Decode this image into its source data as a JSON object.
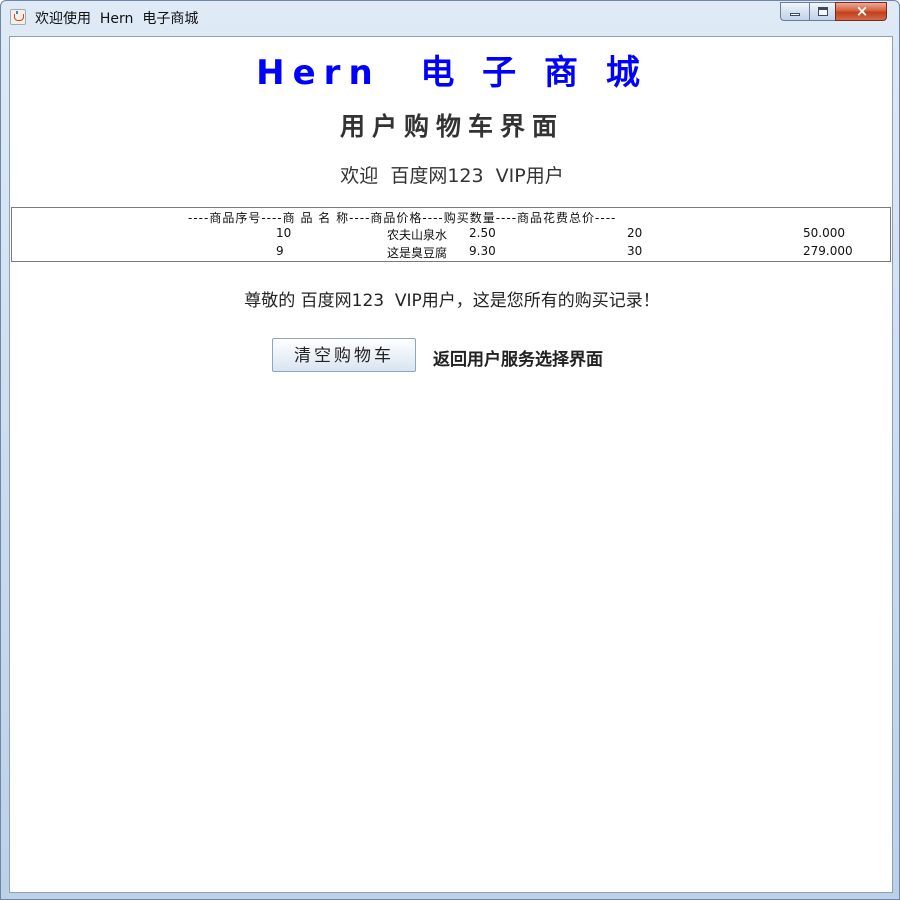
{
  "window": {
    "title": "欢迎使用  Hern  电子商城",
    "icon": "java-cup-icon",
    "controls": {
      "minimize": "minimize-icon",
      "maximize": "maximize-icon",
      "close": "×"
    }
  },
  "header": {
    "shop_title": "Hern  电 子 商 城",
    "page_heading": "用户购物车界面",
    "welcome": "欢迎  百度网123  VIP用户"
  },
  "cart": {
    "header": "----商品序号----商 品 名 称----商品价格----购买数量----商品花费总价----",
    "rows": [
      {
        "id": "10",
        "name": "农夫山泉水",
        "price": "2.50",
        "qty": "20",
        "total": "50.000"
      },
      {
        "id": "9",
        "name": "这是臭豆腐",
        "price": "9.30",
        "qty": "30",
        "total": "279.000"
      }
    ]
  },
  "footer": {
    "record_note": "尊敬的 百度网123  VIP用户，这是您所有的购买记录！",
    "clear_button": "清空购物车",
    "return_link": "返回用户服务选择界面"
  },
  "colors": {
    "accent": "#0000ff",
    "text": "#333333",
    "close_button": "#c2401c"
  }
}
